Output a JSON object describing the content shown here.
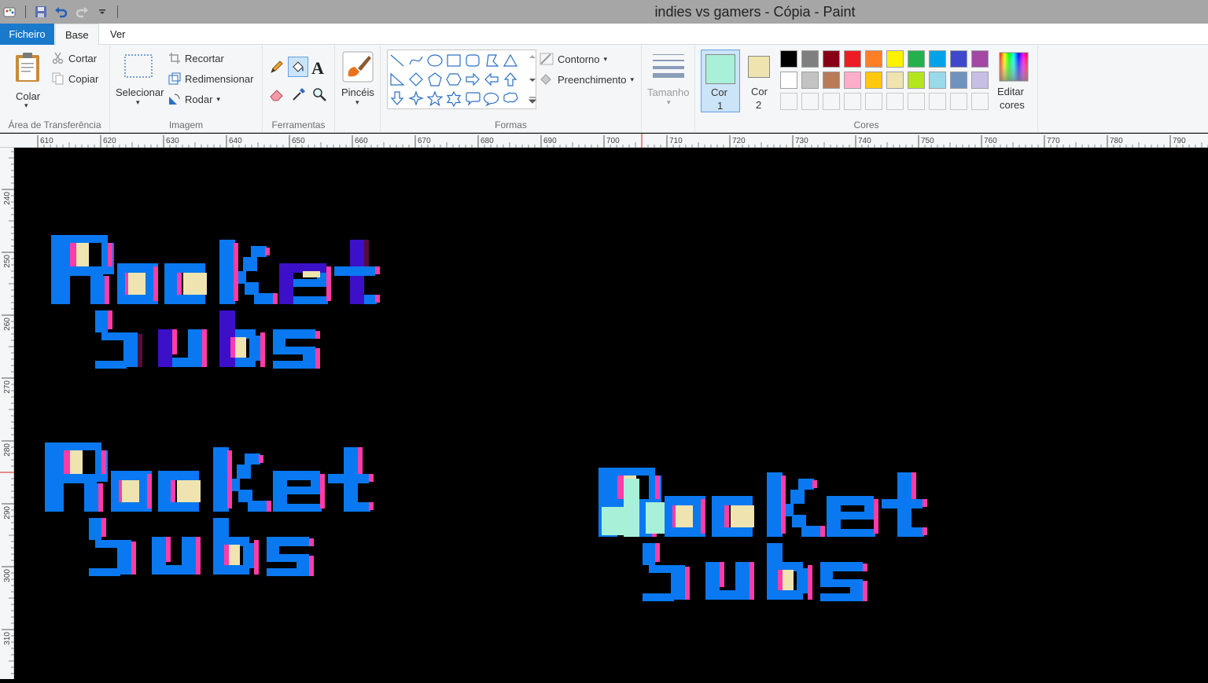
{
  "window": {
    "title": "indies vs gamers - Cópia - Paint"
  },
  "tabs": {
    "file": "Ficheiro",
    "base": "Base",
    "view": "Ver"
  },
  "clipboard": {
    "paste": "Colar",
    "cut": "Cortar",
    "copy": "Copiar",
    "label": "Área de Transferência"
  },
  "image": {
    "select": "Selecionar",
    "crop": "Recortar",
    "resize": "Redimensionar",
    "rotate": "Rodar",
    "label": "Imagem"
  },
  "tools": {
    "label": "Ferramentas"
  },
  "brushes": {
    "label": "Pincéis"
  },
  "shapes": {
    "outline": "Contorno",
    "fill": "Preenchimento",
    "label": "Formas"
  },
  "size": {
    "label": "Tamanho"
  },
  "colors": {
    "color1_label": "Cor\n1",
    "color1_line1": "Cor",
    "color1_line2": "1",
    "color2_line1": "Cor",
    "color2_line2": "2",
    "color1": "#a8f0d8",
    "color2": "#efe4b0",
    "edit_line1": "Editar",
    "edit_line2": "cores",
    "label": "Cores",
    "palette_row1": [
      "#000000",
      "#7f7f7f",
      "#880015",
      "#ed1c24",
      "#ff7f27",
      "#fff200",
      "#22b14c",
      "#00a2e8",
      "#3f48cc",
      "#a349a4"
    ],
    "palette_row2": [
      "#ffffff",
      "#c3c3c3",
      "#b97a57",
      "#ffaec9",
      "#ffc90e",
      "#efe4b0",
      "#b5e61d",
      "#99d9ea",
      "#7092be",
      "#c8bfe7"
    ]
  },
  "ruler": {
    "h_ticks": [
      "610",
      "620",
      "630",
      "640",
      "650",
      "660",
      "670",
      "680",
      "690",
      "700",
      "710",
      "720",
      "730",
      "740",
      "750",
      "760",
      "770",
      "780",
      "790"
    ],
    "v_ticks": [
      "240",
      "250",
      "260",
      "270",
      "280",
      "290",
      "300",
      "310"
    ]
  },
  "canvas_art": {
    "logos": [
      {
        "line1": "Rocket",
        "line2": "Subs"
      },
      {
        "line1": "Rocket",
        "line2": "Subs"
      },
      {
        "line1": "Rocket",
        "line2": "Subs"
      }
    ],
    "logo_colors": {
      "blue": "#0a78f0",
      "pink": "#ff3ca8",
      "purple": "#3b10c8",
      "maroon": "#5a0a3a",
      "cream": "#efe4b0",
      "mint": "#a8f0d8"
    }
  }
}
